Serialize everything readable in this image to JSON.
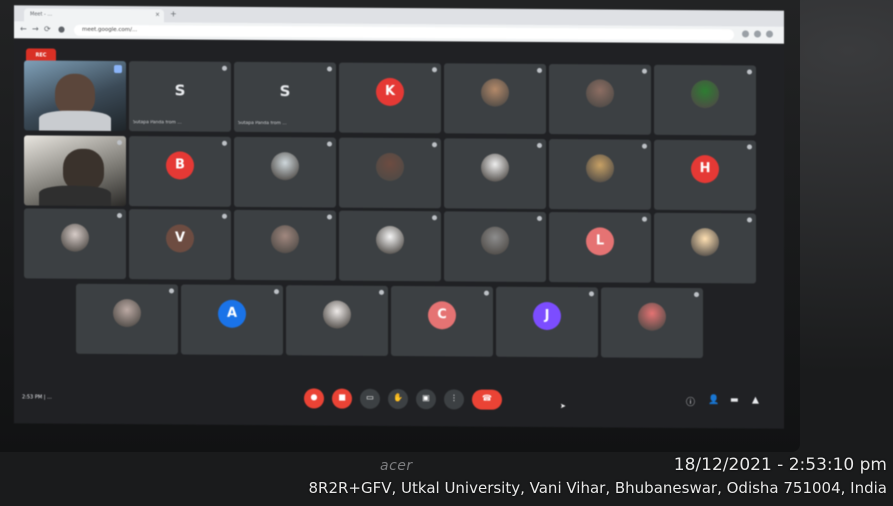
{
  "browser": {
    "tab_title": "Meet - ...",
    "url": "meet.google.com/..."
  },
  "meet": {
    "recording_badge": "REC",
    "participants": [
      {
        "row": 0,
        "name": "",
        "kind": "video"
      },
      {
        "row": 0,
        "name": "Sutapa Panda from ...",
        "kind": "letter-plain",
        "letter": "S"
      },
      {
        "row": 0,
        "name": "Sutapa Panda from ...",
        "kind": "letter-plain",
        "letter": "S"
      },
      {
        "row": 0,
        "name": "",
        "kind": "letter",
        "letter": "K",
        "color": "#e53935"
      },
      {
        "row": 0,
        "name": "",
        "kind": "photo",
        "color": "#b48a6a"
      },
      {
        "row": 0,
        "name": "",
        "kind": "photo",
        "color": "#8d6e63"
      },
      {
        "row": 0,
        "name": "",
        "kind": "photo",
        "color": "#2e7d32"
      },
      {
        "row": 1,
        "name": "",
        "kind": "video2"
      },
      {
        "row": 1,
        "name": "",
        "kind": "letter",
        "letter": "B",
        "color": "#e53935"
      },
      {
        "row": 1,
        "name": "",
        "kind": "photo",
        "color": "#cfd8dc"
      },
      {
        "row": 1,
        "name": "",
        "kind": "photo",
        "color": "#6d4c41"
      },
      {
        "row": 1,
        "name": "",
        "kind": "photo",
        "color": "#eeeeee"
      },
      {
        "row": 1,
        "name": "",
        "kind": "photo",
        "color": "#c8a165"
      },
      {
        "row": 1,
        "name": "",
        "kind": "letter",
        "letter": "H",
        "color": "#e53935"
      },
      {
        "row": 2,
        "name": "",
        "kind": "photo",
        "color": "#d7ccc8"
      },
      {
        "row": 2,
        "name": "",
        "kind": "letter",
        "letter": "V",
        "color": "#6d4c41"
      },
      {
        "row": 2,
        "name": "",
        "kind": "photo",
        "color": "#a1887f"
      },
      {
        "row": 2,
        "name": "",
        "kind": "photo",
        "color": "#f5f5f5"
      },
      {
        "row": 2,
        "name": "",
        "kind": "photo",
        "color": "#8d8d8d"
      },
      {
        "row": 2,
        "name": "",
        "kind": "letter",
        "letter": "L",
        "color": "#e57373"
      },
      {
        "row": 2,
        "name": "",
        "kind": "photo",
        "color": "#ffe0b2"
      },
      {
        "row": 3,
        "name": "",
        "kind": "photo",
        "color": "#bcaaa4"
      },
      {
        "row": 3,
        "name": "",
        "kind": "letter",
        "letter": "A",
        "color": "#1a73e8"
      },
      {
        "row": 3,
        "name": "",
        "kind": "photo",
        "color": "#efebe9"
      },
      {
        "row": 3,
        "name": "",
        "kind": "letter",
        "letter": "C",
        "color": "#e57373"
      },
      {
        "row": 3,
        "name": "",
        "kind": "letter",
        "letter": "J",
        "color": "#7c4dff"
      },
      {
        "row": 3,
        "name": "",
        "kind": "photo",
        "color": "#e57373"
      }
    ],
    "meeting_info": "2:53 PM | ...",
    "controls": {
      "mic": "mic-off",
      "cam": "cam-off",
      "cc": "cc",
      "hand": "hand",
      "present": "present",
      "more": "more",
      "end": "end-call"
    }
  },
  "photo_overlay": {
    "monitor_brand": "acer",
    "timestamp": "18/12/2021 - 2:53:10 pm",
    "location": "8R2R+GFV, Utkal University, Vani Vihar, Bhubaneswar, Odisha 751004, India"
  },
  "colors": {
    "meet_bg": "#202124",
    "tile_bg": "#3c4043",
    "danger": "#ea4335",
    "taskbar": "#5d89b3"
  }
}
